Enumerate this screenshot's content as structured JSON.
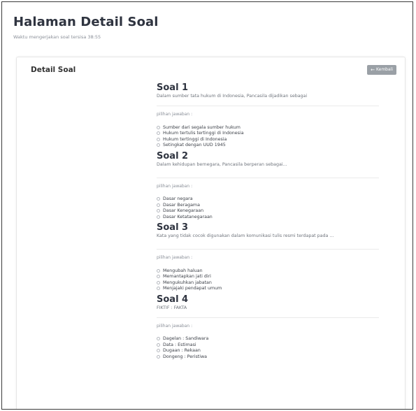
{
  "header": {
    "title": "Halaman Detail Soal",
    "subtitle": "Waktu mengerjakan soal tersisa 38:55"
  },
  "card": {
    "title": "Detail Soal",
    "back_label": "Kembali",
    "back_icon": "arrow-left-icon"
  },
  "answer_label": "pilihan jawaban :",
  "questions": [
    {
      "title": "Soal 1",
      "text": "Dalam sumber tata hukum di Indonesia, Pancasila dijadikan sebagai",
      "options": [
        "Sumber dari segala sumber hukum",
        "Hukum tertulis tertinggi di Indonesia",
        "Hukum tertinggi di Indonesia",
        "Setingkat dengan UUD 1945"
      ]
    },
    {
      "title": "Soal 2",
      "text": "Dalam kehidupan bernegara, Pancasila berperan sebagai...",
      "options": [
        "Dasar negara",
        "Dasar Beragama",
        "Dasar Kenegaraan",
        "Dasar Ketatanegaraan"
      ]
    },
    {
      "title": "Soal 3",
      "text": "Kata yang tidak cocok digunakan dalam komunikasi tulis resmi terdapat pada ...",
      "options": [
        "Mengubah haluan",
        "Memantapkan jati diri",
        "Mengukuhkan jabatan",
        "Menjajaki pendapat umum"
      ]
    },
    {
      "title": "Soal 4",
      "text": "FIKTIF : FAKTA",
      "options": [
        "Dagelan : Sandiwara",
        "Data : Estimasi",
        "Dugaan : Rekaan",
        "Dongeng : Peristiwa"
      ]
    }
  ],
  "colors": {
    "button_bg": "#9aa0a6",
    "title_text": "#2f3440"
  }
}
